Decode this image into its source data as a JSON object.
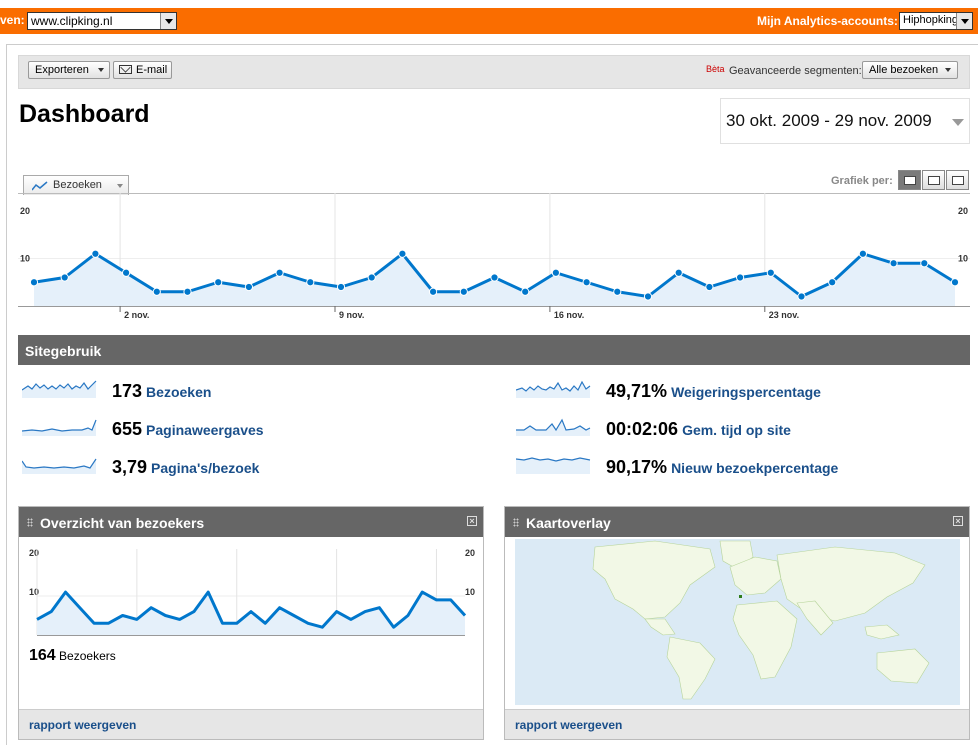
{
  "topbar": {
    "site_label": "ven:",
    "site_value": "www.clipking.nl",
    "accounts_label": "Mijn Analytics-accounts:",
    "account_value": "Hiphopking"
  },
  "toolbar": {
    "export_label": "Exporteren",
    "email_label": "E-mail",
    "beta_label": "Bèta",
    "segments_label": "Geavanceerde segmenten:",
    "segments_value": "Alle bezoeken"
  },
  "page": {
    "title": "Dashboard",
    "date_range": "30 okt. 2009 - 29 nov. 2009"
  },
  "main_chart_header": {
    "metric_tab": "Bezoeken",
    "graph_by_label": "Grafiek per:"
  },
  "chart_data": [
    {
      "type": "area",
      "series": [
        {
          "name": "Bezoeken",
          "values": [
            5,
            6,
            11,
            7,
            3,
            3,
            5,
            4,
            7,
            5,
            4,
            6,
            11,
            3,
            3,
            6,
            3,
            7,
            5,
            3,
            2,
            7,
            4,
            6,
            7,
            2,
            5,
            11,
            9,
            9,
            5
          ]
        }
      ],
      "ylim": [
        0,
        20
      ],
      "yticks": [
        "20",
        "10"
      ],
      "x_tick_labels": [
        {
          "label": "2 nov.",
          "index": 3
        },
        {
          "label": "9 nov.",
          "index": 10
        },
        {
          "label": "16 nov.",
          "index": 17
        },
        {
          "label": "23 nov.",
          "index": 24
        }
      ],
      "line_color": "#0077cc",
      "fill_color": "#e5f0fa"
    },
    {
      "type": "area",
      "series": [
        {
          "name": "Bezoekers",
          "values": [
            4,
            6,
            11,
            7,
            3,
            3,
            5,
            4,
            7,
            5,
            4,
            6,
            11,
            3,
            3,
            6,
            3,
            7,
            5,
            3,
            2,
            6,
            4,
            6,
            7,
            2,
            5,
            11,
            9,
            9,
            5
          ]
        }
      ],
      "ylim": [
        0,
        20
      ],
      "yticks": [
        "20",
        "10"
      ],
      "line_color": "#0077cc",
      "fill_color": "#e5f0fa"
    }
  ],
  "site_usage": {
    "header": "Sitegebruik",
    "metrics": [
      {
        "value": "173",
        "label": "Bezoeken",
        "icon": "sparkline-icon"
      },
      {
        "value": "655",
        "label": "Paginaweergaves",
        "icon": "sparkline-icon"
      },
      {
        "value": "3,79",
        "label": "Pagina's/bezoek",
        "icon": "sparkline-icon"
      },
      {
        "value": "49,71%",
        "label": "Weigeringspercentage",
        "icon": "sparkline-icon"
      },
      {
        "value": "00:02:06",
        "label": "Gem. tijd op site",
        "icon": "sparkline-icon"
      },
      {
        "value": "90,17%",
        "label": "Nieuw bezoekpercentage",
        "icon": "sparkline-icon"
      }
    ]
  },
  "widgets": {
    "visitors": {
      "title": "Overzicht van bezoekers",
      "count": "164",
      "count_label": "Bezoekers",
      "footer_link": "rapport weergeven"
    },
    "map": {
      "title": "Kaartoverlay",
      "footer_link": "rapport weergeven"
    }
  }
}
